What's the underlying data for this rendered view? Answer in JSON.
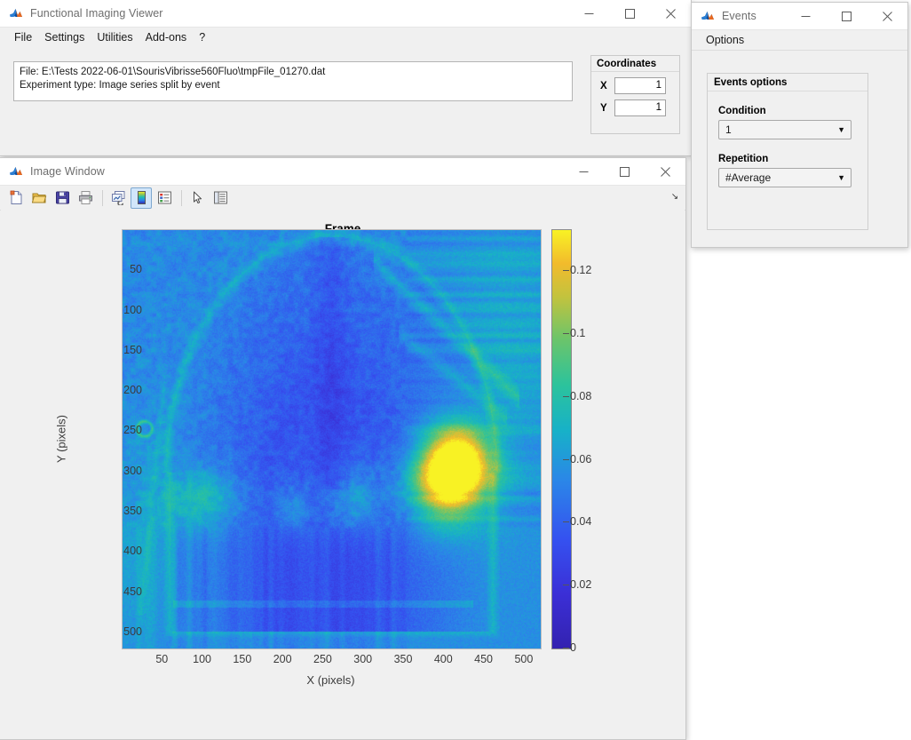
{
  "main_window": {
    "title": "Functional Imaging Viewer",
    "icon": "matlab-icon",
    "menu": [
      "File",
      "Settings",
      "Utilities",
      "Add-ons",
      "?"
    ],
    "controls": {
      "minimize": "—",
      "maximize": "□",
      "close": "✕"
    },
    "info": {
      "file_line": "File: E:\\Tests 2022-06-01\\SourisVibrisse560Fluo\\tmpFile_01270.dat",
      "experiment_line": "Experiment type: Image series split by event"
    },
    "coordinates": {
      "title": "Coordinates",
      "x_label": "X",
      "x_value": "1",
      "y_label": "Y",
      "y_value": "1"
    }
  },
  "image_window": {
    "title": "Image Window",
    "icon": "matlab-icon",
    "controls": {
      "minimize": "—",
      "maximize": "□",
      "close": "✕"
    },
    "toolbar": [
      {
        "name": "new-figure-icon",
        "tip": "New Figure",
        "active": false
      },
      {
        "name": "open-file-icon",
        "tip": "Open File",
        "active": false
      },
      {
        "name": "save-figure-icon",
        "tip": "Save Figure",
        "active": false
      },
      {
        "name": "print-figure-icon",
        "tip": "Print Figure",
        "active": false
      },
      {
        "name": "link-plot-icon",
        "tip": "Link Plot",
        "active": false
      },
      {
        "name": "colorbar-icon",
        "tip": "Insert Colorbar",
        "active": true
      },
      {
        "name": "legend-icon",
        "tip": "Insert Legend",
        "active": false
      },
      {
        "name": "pointer-select-icon",
        "tip": "Edit Plot",
        "active": false
      },
      {
        "name": "property-inspector-icon",
        "tip": "Open Property Inspector",
        "active": false
      }
    ],
    "toolbar_overflow": "↘"
  },
  "events_window": {
    "title": "Events",
    "icon": "matlab-icon",
    "controls": {
      "minimize": "—",
      "maximize": "□",
      "close": "✕"
    },
    "menu": [
      "Options"
    ],
    "panel": {
      "title": "Events options",
      "condition_label": "Condition",
      "condition_value": "1",
      "repetition_label": "Repetition",
      "repetition_value": "#Average",
      "caret": "▼"
    }
  },
  "chart_data": {
    "type": "heatmap",
    "title": "Frame",
    "xlabel": "X (pixels)",
    "ylabel": "Y (pixels)",
    "xticks": [
      50,
      100,
      150,
      200,
      250,
      300,
      350,
      400,
      450,
      500
    ],
    "yticks": [
      50,
      100,
      150,
      200,
      250,
      300,
      350,
      400,
      450,
      500
    ],
    "xlim": [
      0,
      520
    ],
    "ylim": [
      0,
      520
    ],
    "grid": false,
    "legend": "colorbar-right",
    "colorbar": {
      "ticks": [
        0,
        0.02,
        0.04,
        0.06,
        0.08,
        0.1,
        0.12
      ],
      "tick_labels": [
        "0",
        "0.02",
        "0.04",
        "0.06",
        "0.08",
        "0.1",
        "0.12"
      ],
      "vmin": 0,
      "vmax": 0.133,
      "colormap_name": "jet-parula-hybrid",
      "colormap_stops": [
        {
          "t": 0.0,
          "hex": "#3322b0"
        },
        {
          "t": 0.13,
          "hex": "#3b2fd6"
        },
        {
          "t": 0.26,
          "hex": "#3551f0"
        },
        {
          "t": 0.4,
          "hex": "#2b86e8"
        },
        {
          "t": 0.52,
          "hex": "#17b1c8"
        },
        {
          "t": 0.63,
          "hex": "#2cc39c"
        },
        {
          "t": 0.74,
          "hex": "#6cc46a"
        },
        {
          "t": 0.84,
          "hex": "#c2c33e"
        },
        {
          "t": 0.92,
          "hex": "#f2bb2c"
        },
        {
          "t": 1.0,
          "hex": "#f8f224"
        }
      ]
    },
    "description": "Intrinsic optical / fluorescence functional image of a mouse dorsal cortex through the skull. Background is mid-blue noise; the cortical dome is darker blue; bright yellow-orange activation blob on the right hemisphere near X~400 Y~270; weaker cyan-green bilateral patches near Y~330; bright yellow speckled blood-vessel / skull-edge arcs outline the dome.",
    "hotspots": [
      {
        "cx": 0.8,
        "cy": 0.545,
        "rx": 0.075,
        "ry": 0.075,
        "value": 0.125,
        "hex": "#f5a62a"
      },
      {
        "cx": 0.775,
        "cy": 0.62,
        "rx": 0.085,
        "ry": 0.085,
        "value": 0.1,
        "hex": "#d5c233"
      },
      {
        "cx": 0.195,
        "cy": 0.645,
        "rx": 0.085,
        "ry": 0.075,
        "value": 0.066,
        "hex": "#36c3a4"
      },
      {
        "cx": 0.555,
        "cy": 0.645,
        "rx": 0.075,
        "ry": 0.08,
        "value": 0.064,
        "hex": "#32c1ac"
      },
      {
        "cx": 0.405,
        "cy": 0.665,
        "rx": 0.055,
        "ry": 0.065,
        "value": 0.058,
        "hex": "#2bb8c0"
      }
    ]
  }
}
